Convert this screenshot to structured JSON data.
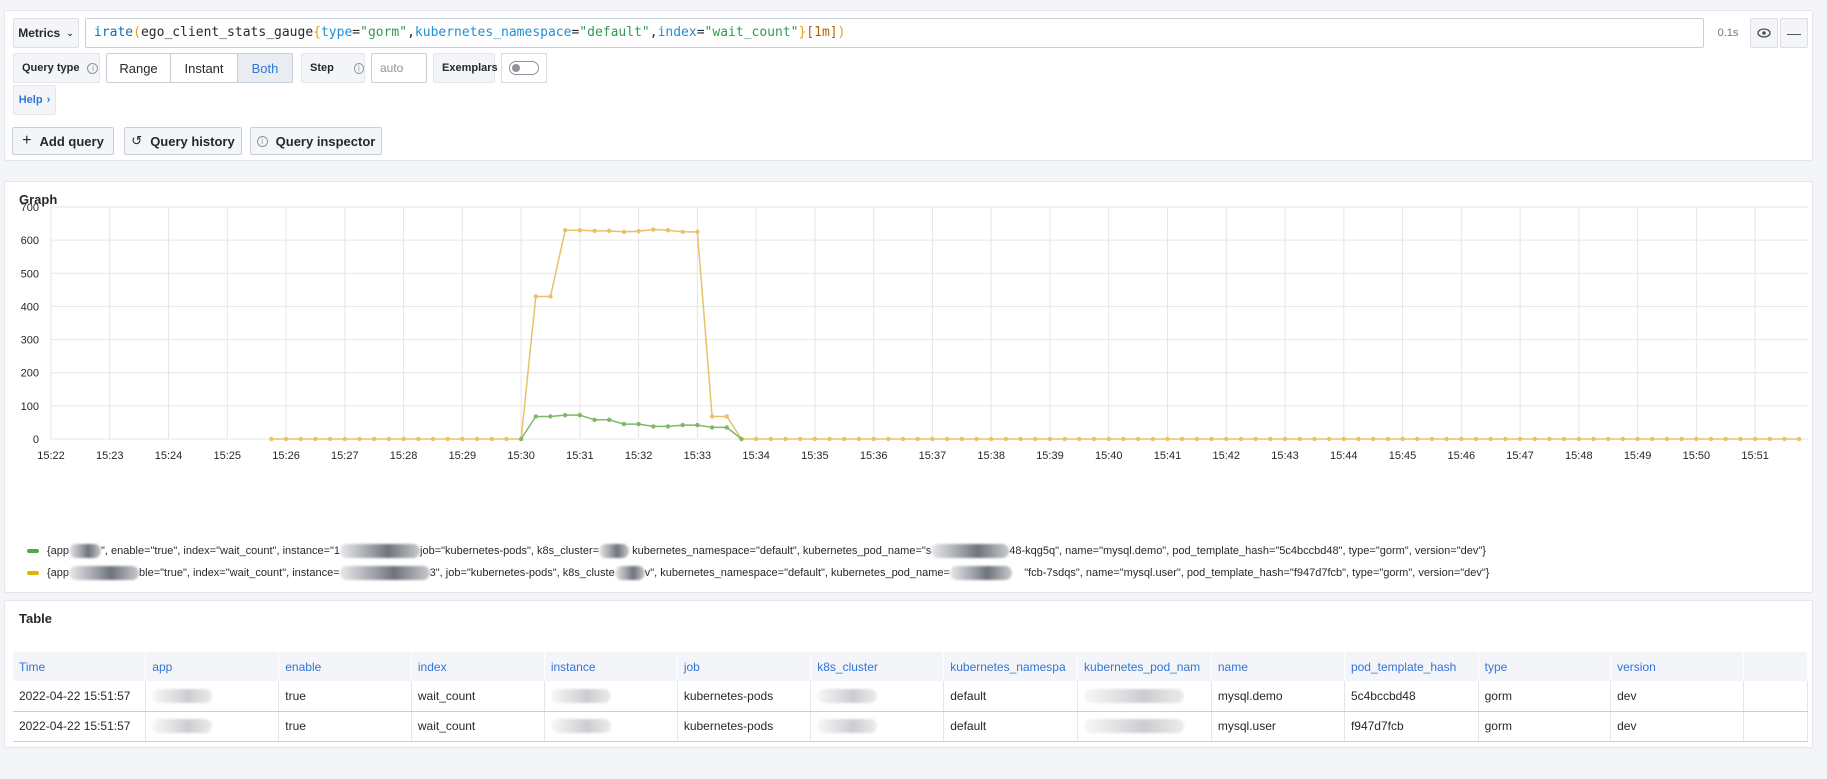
{
  "query_row": {
    "metrics_label": "Metrics",
    "query_tokens": [
      {
        "t": "irate",
        "c": "fn"
      },
      {
        "t": "(",
        "c": "br"
      },
      {
        "t": "ego_client_stats_gauge",
        "c": "plain"
      },
      {
        "t": "{",
        "c": "br"
      },
      {
        "t": "type",
        "c": "key"
      },
      {
        "t": "=",
        "c": "plain"
      },
      {
        "t": "\"gorm\"",
        "c": "str"
      },
      {
        "t": ",",
        "c": "plain"
      },
      {
        "t": "kubernetes_namespace",
        "c": "key"
      },
      {
        "t": "=",
        "c": "plain"
      },
      {
        "t": "\"default\"",
        "c": "str"
      },
      {
        "t": ",",
        "c": "plain"
      },
      {
        "t": "index",
        "c": "key"
      },
      {
        "t": "=",
        "c": "plain"
      },
      {
        "t": "\"wait_count\"",
        "c": "str"
      },
      {
        "t": "}",
        "c": "br"
      },
      {
        "t": "[1m]",
        "c": "range"
      },
      {
        "t": ")",
        "c": "br"
      }
    ],
    "duration": "0.1s"
  },
  "options_row": {
    "query_type_label": "Query type",
    "query_types": [
      "Range",
      "Instant",
      "Both"
    ],
    "active_query_type": "Both",
    "step_label": "Step",
    "step_placeholder": "auto",
    "exemplars_label": "Exemplars",
    "exemplars_enabled": false
  },
  "help_label": "Help",
  "actions": {
    "add_query": "Add query",
    "query_history": "Query history",
    "query_inspector": "Query inspector"
  },
  "graph": {
    "title": "Graph",
    "legend": [
      {
        "color": "#56a64b",
        "parts": [
          "{app",
          "\", enable=\"true\", index=\"wait_count\", instance=\"1",
          "job=\"kubernetes-pods\", k8s_cluster=",
          "kubernetes_namespace=\"default\", kubernetes_pod_name=\"s",
          "48-kqg5q\", name=\"mysql.demo\", pod_template_hash=\"5c4bccbd48\", type=\"gorm\", version=\"dev\"}"
        ]
      },
      {
        "color": "#e0b400",
        "parts": [
          "{app",
          "ble=\"true\", index=\"wait_count\", instance=",
          "3\", job=\"kubernetes-pods\", k8s_cluste",
          "v\", kubernetes_namespace=\"default\", kubernetes_pod_name=",
          "\"fcb-7sdqs\", name=\"mysql.user\", pod_template_hash=\"f947d7fcb\", type=\"gorm\", version=\"dev\"}"
        ]
      }
    ]
  },
  "chart_data": {
    "type": "line",
    "x_ticks": [
      "15:22",
      "15:23",
      "15:24",
      "15:25",
      "15:26",
      "15:27",
      "15:28",
      "15:29",
      "15:30",
      "15:31",
      "15:32",
      "15:33",
      "15:34",
      "15:35",
      "15:36",
      "15:37",
      "15:38",
      "15:39",
      "15:40",
      "15:41",
      "15:42",
      "15:43",
      "15:44",
      "15:45",
      "15:46",
      "15:47",
      "15:48",
      "15:49",
      "15:50",
      "15:51"
    ],
    "y_ticks": [
      0,
      100,
      200,
      300,
      400,
      500,
      600,
      700
    ],
    "ylim": [
      0,
      700
    ],
    "x_unit_note_minutes_start": "15:22",
    "x_range_minutes": [
      0,
      29.9
    ],
    "grid": true,
    "legend_position": "bottom",
    "series": [
      {
        "color": "#e8c26a",
        "points": [
          [
            3.75,
            0
          ],
          [
            4.0,
            0
          ],
          [
            4.25,
            0
          ],
          [
            4.5,
            0
          ],
          [
            4.75,
            0
          ],
          [
            5.0,
            0
          ],
          [
            5.25,
            0
          ],
          [
            5.5,
            0
          ],
          [
            5.75,
            0
          ],
          [
            6.0,
            0
          ],
          [
            6.25,
            0
          ],
          [
            6.5,
            0
          ],
          [
            6.75,
            0
          ],
          [
            7.0,
            0
          ],
          [
            7.25,
            0
          ],
          [
            7.5,
            0
          ],
          [
            7.75,
            0
          ],
          [
            8.0,
            0
          ],
          [
            8.25,
            430
          ],
          [
            8.5,
            430
          ],
          [
            8.75,
            630
          ],
          [
            9.0,
            630
          ],
          [
            9.25,
            628
          ],
          [
            9.5,
            628
          ],
          [
            9.75,
            625
          ],
          [
            10.0,
            627
          ],
          [
            10.25,
            632
          ],
          [
            10.5,
            630
          ],
          [
            10.75,
            625
          ],
          [
            11.0,
            625
          ],
          [
            11.25,
            68
          ],
          [
            11.5,
            68
          ],
          [
            11.75,
            0
          ],
          [
            12.0,
            0
          ],
          [
            12.25,
            0
          ],
          [
            12.5,
            0
          ],
          [
            12.75,
            0
          ],
          [
            13.0,
            0
          ],
          [
            13.25,
            0
          ],
          [
            13.5,
            0
          ],
          [
            13.75,
            0
          ],
          [
            14.0,
            0
          ],
          [
            14.25,
            0
          ],
          [
            14.5,
            0
          ],
          [
            14.75,
            0
          ],
          [
            15.0,
            0
          ],
          [
            15.25,
            0
          ],
          [
            15.5,
            0
          ],
          [
            15.75,
            0
          ],
          [
            16.0,
            0
          ],
          [
            16.25,
            0
          ],
          [
            16.5,
            0
          ],
          [
            16.75,
            0
          ],
          [
            17.0,
            0
          ],
          [
            17.25,
            0
          ],
          [
            17.5,
            0
          ],
          [
            17.75,
            0
          ],
          [
            18.0,
            0
          ],
          [
            18.25,
            0
          ],
          [
            18.5,
            0
          ],
          [
            18.75,
            0
          ],
          [
            19.0,
            0
          ],
          [
            19.25,
            0
          ],
          [
            19.5,
            0
          ],
          [
            19.75,
            0
          ],
          [
            20.0,
            0
          ],
          [
            20.25,
            0
          ],
          [
            20.5,
            0
          ],
          [
            20.75,
            0
          ],
          [
            21.0,
            0
          ],
          [
            21.25,
            0
          ],
          [
            21.5,
            0
          ],
          [
            21.75,
            0
          ],
          [
            22.0,
            0
          ],
          [
            22.25,
            0
          ],
          [
            22.5,
            0
          ],
          [
            22.75,
            0
          ],
          [
            23.0,
            0
          ],
          [
            23.25,
            0
          ],
          [
            23.5,
            0
          ],
          [
            23.75,
            0
          ],
          [
            24.0,
            0
          ],
          [
            24.25,
            0
          ],
          [
            24.5,
            0
          ],
          [
            24.75,
            0
          ],
          [
            25.0,
            0
          ],
          [
            25.25,
            0
          ],
          [
            25.5,
            0
          ],
          [
            25.75,
            0
          ],
          [
            26.0,
            0
          ],
          [
            26.25,
            0
          ],
          [
            26.5,
            0
          ],
          [
            26.75,
            0
          ],
          [
            27.0,
            0
          ],
          [
            27.25,
            0
          ],
          [
            27.5,
            0
          ],
          [
            27.75,
            0
          ],
          [
            28.0,
            0
          ],
          [
            28.25,
            0
          ],
          [
            28.5,
            0
          ],
          [
            28.75,
            0
          ],
          [
            29.0,
            0
          ],
          [
            29.25,
            0
          ],
          [
            29.5,
            0
          ],
          [
            29.75,
            0
          ]
        ]
      },
      {
        "color": "#7fb86b",
        "points": [
          [
            8.0,
            0
          ],
          [
            8.25,
            68
          ],
          [
            8.5,
            68
          ],
          [
            8.75,
            72
          ],
          [
            9.0,
            72
          ],
          [
            9.25,
            58
          ],
          [
            9.5,
            58
          ],
          [
            9.75,
            45
          ],
          [
            10.0,
            45
          ],
          [
            10.25,
            38
          ],
          [
            10.5,
            38
          ],
          [
            10.75,
            42
          ],
          [
            11.0,
            42
          ],
          [
            11.25,
            35
          ],
          [
            11.5,
            35
          ],
          [
            11.75,
            0
          ]
        ]
      }
    ]
  },
  "table": {
    "title": "Table",
    "columns": [
      "Time",
      "app",
      "enable",
      "index",
      "instance",
      "job",
      "k8s_cluster",
      "kubernetes_namespa",
      "kubernetes_pod_nam",
      "name",
      "pod_template_hash",
      "type",
      "version",
      ""
    ],
    "rows": [
      [
        "2022-04-22 15:51:57",
        "",
        "true",
        "wait_count",
        "",
        "kubernetes-pods",
        "",
        "default",
        "",
        "mysql.demo",
        "5c4bccbd48",
        "gorm",
        "dev",
        ""
      ],
      [
        "2022-04-22 15:51:57",
        "",
        "true",
        "wait_count",
        "",
        "kubernetes-pods",
        "",
        "default",
        "",
        "mysql.user",
        "f947d7fcb",
        "gorm",
        "dev",
        ""
      ]
    ]
  }
}
